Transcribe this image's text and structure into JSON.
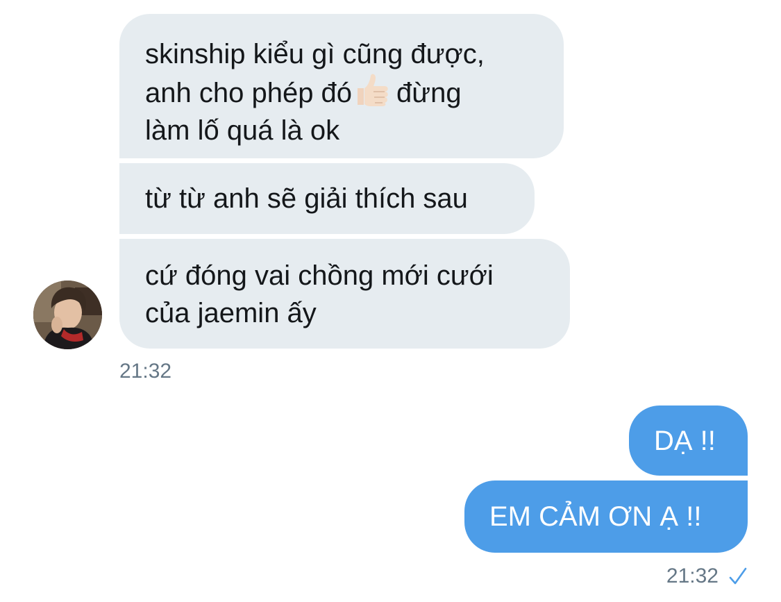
{
  "incoming": {
    "messages": [
      {
        "lines": [
          "skinship kiểu gì cũng được,",
          "anh cho phép đó",
          "đừng",
          "làm lố quá là ok"
        ]
      },
      {
        "lines": [
          "từ từ anh sẽ giải thích sau"
        ]
      },
      {
        "lines": [
          "cứ đóng vai chồng mới cưới",
          "của jaemin ấy"
        ]
      }
    ],
    "timestamp": "21:32",
    "avatar_icon": "user-avatar-photo"
  },
  "outgoing": {
    "messages": [
      {
        "text": "DẠ !!"
      },
      {
        "text": "EM CẢM ƠN Ạ !!"
      }
    ],
    "timestamp": "21:32",
    "status_icon": "check-icon"
  },
  "colors": {
    "incoming_bubble": "#e6ecf0",
    "outgoing_bubble": "#4d9de8",
    "timestamp": "#657786"
  }
}
